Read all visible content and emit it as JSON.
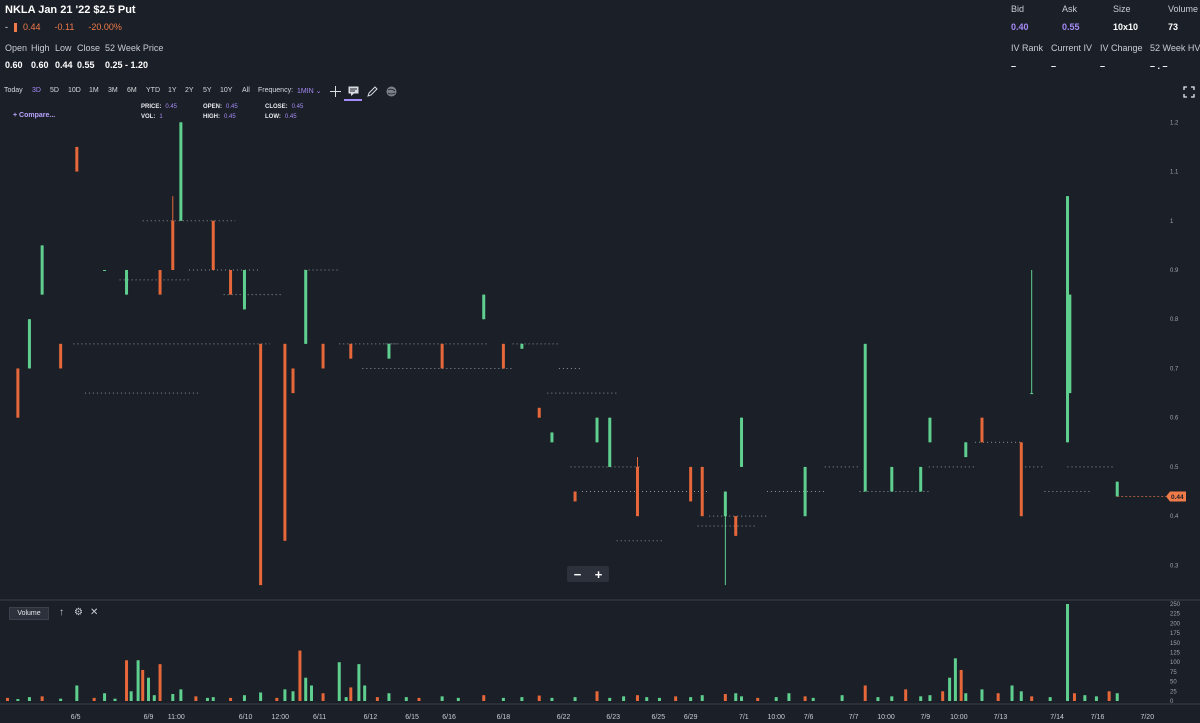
{
  "header": {
    "title": "NKLA Jan 21 '22 $2.5 Put",
    "change_dash": "-",
    "last": "0.44",
    "change": "-0.11",
    "change_pct": "-20.00%"
  },
  "ohlc": {
    "labels": [
      "Open",
      "High",
      "Low",
      "Close",
      "52 Week Price"
    ],
    "values": [
      "0.60",
      "0.60",
      "0.44",
      "0.55",
      "0.25 - 1.20"
    ]
  },
  "quote": {
    "bid_label": "Bid",
    "bid": "0.40",
    "ask_label": "Ask",
    "ask": "0.55",
    "size_label": "Size",
    "size": "10x10",
    "volume_label": "Volume",
    "volume": "73",
    "iv_rank_label": "IV Rank",
    "iv_rank": "–",
    "current_iv_label": "Current IV",
    "current_iv": "–",
    "iv_change_label": "IV Change",
    "iv_change": "–",
    "hv_label": "52 Week HV",
    "hv": "– . –"
  },
  "toolbar": {
    "timeframes": [
      "Today",
      "3D",
      "5D",
      "10D",
      "1M",
      "3M",
      "6M",
      "YTD",
      "1Y",
      "2Y",
      "5Y",
      "10Y",
      "All"
    ],
    "active_timeframe": "3D",
    "frequency_label": "Frequency:",
    "frequency_value": "1MIN ⌄"
  },
  "compare_label": "+ Compare...",
  "legend": {
    "price_label": "PRICE:",
    "price": "0.45",
    "vol_label": "VOL:",
    "vol": "1",
    "open_label": "OPEN:",
    "open": "0.45",
    "high_label": "HIGH:",
    "high": "0.45",
    "close_label": "CLOSE:",
    "close": "0.45",
    "low_label": "LOW:",
    "low": "0.45"
  },
  "volume_panel": {
    "title": "Volume"
  },
  "colors": {
    "up": "#5fcf8f",
    "down": "#e5673a",
    "accent": "#a58bf7",
    "background": "#1b1f27",
    "last_price_tag": "#f07b4a"
  },
  "icons": [
    "crosshair-icon",
    "annotation-icon",
    "pencil-icon",
    "globe-icon",
    "fullscreen-icon",
    "arrow-up-icon",
    "gear-icon",
    "close-icon"
  ],
  "chart_data": {
    "type": "candlestick",
    "x_tick_labels": [
      "6/5",
      "6/9",
      "11:00",
      "6/10",
      "12:00",
      "6/11",
      "6/12",
      "6/15",
      "6/16",
      "6/18",
      "6/22",
      "6/23",
      "6/25",
      "6/29",
      "7/1",
      "10:00",
      "7/6",
      "7/7",
      "10:00",
      "7/9",
      "10:00",
      "7/13",
      "7/14",
      "7/16",
      "7/20"
    ],
    "y_ticks": [
      0.3,
      0.4,
      0.5,
      0.6,
      0.7,
      0.8,
      0.9,
      1,
      1.1,
      1.2
    ],
    "y_tick_labels": [
      "0.3",
      "0.4",
      "0.5",
      "0.6",
      "0.7",
      "0.8",
      "0.9",
      "1",
      "1.1",
      "1.2"
    ],
    "ylim": [
      0.25,
      1.2
    ],
    "last_price": 0.44,
    "last_price_label": "0.44",
    "volume_ticks": [
      0,
      25,
      50,
      75,
      100,
      125,
      150,
      175,
      200,
      225,
      250
    ],
    "volume_ylim": [
      0,
      250
    ],
    "candles": [
      {
        "x": 0.012,
        "o": 0.7,
        "h": 0.7,
        "l": 0.6,
        "c": 0.6
      },
      {
        "x": 0.022,
        "o": 0.7,
        "h": 0.8,
        "l": 0.7,
        "c": 0.8
      },
      {
        "x": 0.033,
        "o": 0.85,
        "h": 0.95,
        "l": 0.85,
        "c": 0.95
      },
      {
        "x": 0.049,
        "o": 0.75,
        "h": 0.75,
        "l": 0.7,
        "c": 0.7
      },
      {
        "x": 0.063,
        "o": 1.15,
        "h": 1.15,
        "l": 1.1,
        "c": 1.1
      },
      {
        "x": 0.087,
        "o": 0.9,
        "h": 0.9,
        "l": 0.9,
        "c": 0.9
      },
      {
        "x": 0.106,
        "o": 0.85,
        "h": 0.9,
        "l": 0.85,
        "c": 0.9
      },
      {
        "x": 0.135,
        "o": 0.9,
        "h": 0.9,
        "l": 0.85,
        "c": 0.85
      },
      {
        "x": 0.146,
        "o": 1.0,
        "h": 1.05,
        "l": 0.9,
        "c": 0.9
      },
      {
        "x": 0.153,
        "o": 1.0,
        "h": 1.2,
        "l": 1.0,
        "c": 1.2
      },
      {
        "x": 0.181,
        "o": 1.0,
        "h": 1.0,
        "l": 0.9,
        "c": 0.9
      },
      {
        "x": 0.196,
        "o": 0.9,
        "h": 0.9,
        "l": 0.85,
        "c": 0.85
      },
      {
        "x": 0.208,
        "o": 0.82,
        "h": 0.9,
        "l": 0.82,
        "c": 0.9
      },
      {
        "x": 0.222,
        "o": 0.75,
        "h": 0.75,
        "l": 0.26,
        "c": 0.26
      },
      {
        "x": 0.243,
        "o": 0.75,
        "h": 0.75,
        "l": 0.35,
        "c": 0.35
      },
      {
        "x": 0.25,
        "o": 0.7,
        "h": 0.7,
        "l": 0.65,
        "c": 0.65
      },
      {
        "x": 0.261,
        "o": 0.75,
        "h": 0.9,
        "l": 0.75,
        "c": 0.9
      },
      {
        "x": 0.276,
        "o": 0.75,
        "h": 0.75,
        "l": 0.7,
        "c": 0.7
      },
      {
        "x": 0.3,
        "o": 0.75,
        "h": 0.75,
        "l": 0.72,
        "c": 0.72
      },
      {
        "x": 0.333,
        "o": 0.72,
        "h": 0.75,
        "l": 0.72,
        "c": 0.75
      },
      {
        "x": 0.379,
        "o": 0.75,
        "h": 0.75,
        "l": 0.7,
        "c": 0.7
      },
      {
        "x": 0.415,
        "o": 0.8,
        "h": 0.85,
        "l": 0.8,
        "c": 0.85
      },
      {
        "x": 0.432,
        "o": 0.75,
        "h": 0.75,
        "l": 0.7,
        "c": 0.7
      },
      {
        "x": 0.448,
        "o": 0.74,
        "h": 0.75,
        "l": 0.74,
        "c": 0.75
      },
      {
        "x": 0.463,
        "o": 0.62,
        "h": 0.62,
        "l": 0.6,
        "c": 0.6
      },
      {
        "x": 0.474,
        "o": 0.55,
        "h": 0.57,
        "l": 0.55,
        "c": 0.57
      },
      {
        "x": 0.494,
        "o": 0.45,
        "h": 0.45,
        "l": 0.43,
        "c": 0.43
      },
      {
        "x": 0.513,
        "o": 0.55,
        "h": 0.6,
        "l": 0.55,
        "c": 0.6
      },
      {
        "x": 0.524,
        "o": 0.5,
        "h": 0.6,
        "l": 0.5,
        "c": 0.6
      },
      {
        "x": 0.548,
        "o": 0.5,
        "h": 0.52,
        "l": 0.4,
        "c": 0.4
      },
      {
        "x": 0.594,
        "o": 0.5,
        "h": 0.5,
        "l": 0.43,
        "c": 0.43
      },
      {
        "x": 0.604,
        "o": 0.5,
        "h": 0.5,
        "l": 0.4,
        "c": 0.4
      },
      {
        "x": 0.624,
        "o": 0.4,
        "h": 0.45,
        "l": 0.26,
        "c": 0.45
      },
      {
        "x": 0.633,
        "o": 0.4,
        "h": 0.4,
        "l": 0.36,
        "c": 0.36
      },
      {
        "x": 0.638,
        "o": 0.5,
        "h": 0.6,
        "l": 0.5,
        "c": 0.6
      },
      {
        "x": 0.693,
        "o": 0.4,
        "h": 0.5,
        "l": 0.4,
        "c": 0.5
      },
      {
        "x": 0.745,
        "o": 0.45,
        "h": 0.75,
        "l": 0.45,
        "c": 0.75
      },
      {
        "x": 0.768,
        "o": 0.45,
        "h": 0.5,
        "l": 0.45,
        "c": 0.5
      },
      {
        "x": 0.793,
        "o": 0.45,
        "h": 0.5,
        "l": 0.45,
        "c": 0.5
      },
      {
        "x": 0.801,
        "o": 0.55,
        "h": 0.6,
        "l": 0.55,
        "c": 0.6
      },
      {
        "x": 0.832,
        "o": 0.52,
        "h": 0.55,
        "l": 0.52,
        "c": 0.55
      },
      {
        "x": 0.846,
        "o": 0.6,
        "h": 0.6,
        "l": 0.55,
        "c": 0.55
      },
      {
        "x": 0.88,
        "o": 0.55,
        "h": 0.55,
        "l": 0.4,
        "c": 0.4
      },
      {
        "x": 0.889,
        "o": 0.65,
        "h": 0.9,
        "l": 0.65,
        "c": 0.65
      },
      {
        "x": 0.92,
        "o": 0.55,
        "h": 1.05,
        "l": 0.55,
        "c": 1.05
      },
      {
        "x": 0.922,
        "o": 0.65,
        "h": 0.85,
        "l": 0.65,
        "c": 0.85
      },
      {
        "x": 0.963,
        "o": 0.44,
        "h": 0.47,
        "l": 0.44,
        "c": 0.47
      }
    ],
    "volumes": [
      {
        "x": 0.003,
        "v": 8
      },
      {
        "x": 0.012,
        "v": 5
      },
      {
        "x": 0.022,
        "v": 10
      },
      {
        "x": 0.033,
        "v": 12
      },
      {
        "x": 0.049,
        "v": 6
      },
      {
        "x": 0.063,
        "v": 40
      },
      {
        "x": 0.078,
        "v": 8
      },
      {
        "x": 0.087,
        "v": 20
      },
      {
        "x": 0.096,
        "v": 6
      },
      {
        "x": 0.106,
        "v": 105
      },
      {
        "x": 0.11,
        "v": 25
      },
      {
        "x": 0.116,
        "v": 105
      },
      {
        "x": 0.12,
        "v": 80
      },
      {
        "x": 0.125,
        "v": 60
      },
      {
        "x": 0.13,
        "v": 15
      },
      {
        "x": 0.135,
        "v": 95
      },
      {
        "x": 0.146,
        "v": 18
      },
      {
        "x": 0.153,
        "v": 30
      },
      {
        "x": 0.166,
        "v": 12
      },
      {
        "x": 0.176,
        "v": 8
      },
      {
        "x": 0.181,
        "v": 10
      },
      {
        "x": 0.196,
        "v": 8
      },
      {
        "x": 0.208,
        "v": 15
      },
      {
        "x": 0.222,
        "v": 22
      },
      {
        "x": 0.236,
        "v": 8
      },
      {
        "x": 0.243,
        "v": 30
      },
      {
        "x": 0.25,
        "v": 25
      },
      {
        "x": 0.256,
        "v": 130
      },
      {
        "x": 0.261,
        "v": 60
      },
      {
        "x": 0.266,
        "v": 40
      },
      {
        "x": 0.276,
        "v": 20
      },
      {
        "x": 0.29,
        "v": 100
      },
      {
        "x": 0.296,
        "v": 10
      },
      {
        "x": 0.3,
        "v": 35
      },
      {
        "x": 0.307,
        "v": 95
      },
      {
        "x": 0.312,
        "v": 40
      },
      {
        "x": 0.323,
        "v": 10
      },
      {
        "x": 0.333,
        "v": 20
      },
      {
        "x": 0.348,
        "v": 10
      },
      {
        "x": 0.359,
        "v": 8
      },
      {
        "x": 0.379,
        "v": 12
      },
      {
        "x": 0.393,
        "v": 8
      },
      {
        "x": 0.415,
        "v": 15
      },
      {
        "x": 0.432,
        "v": 8
      },
      {
        "x": 0.448,
        "v": 10
      },
      {
        "x": 0.463,
        "v": 14
      },
      {
        "x": 0.474,
        "v": 8
      },
      {
        "x": 0.494,
        "v": 10
      },
      {
        "x": 0.513,
        "v": 25
      },
      {
        "x": 0.524,
        "v": 8
      },
      {
        "x": 0.536,
        "v": 12
      },
      {
        "x": 0.548,
        "v": 15
      },
      {
        "x": 0.556,
        "v": 10
      },
      {
        "x": 0.567,
        "v": 8
      },
      {
        "x": 0.581,
        "v": 12
      },
      {
        "x": 0.594,
        "v": 10
      },
      {
        "x": 0.604,
        "v": 15
      },
      {
        "x": 0.624,
        "v": 18
      },
      {
        "x": 0.633,
        "v": 20
      },
      {
        "x": 0.638,
        "v": 12
      },
      {
        "x": 0.652,
        "v": 8
      },
      {
        "x": 0.668,
        "v": 10
      },
      {
        "x": 0.679,
        "v": 20
      },
      {
        "x": 0.693,
        "v": 12
      },
      {
        "x": 0.7,
        "v": 8
      },
      {
        "x": 0.725,
        "v": 15
      },
      {
        "x": 0.745,
        "v": 40
      },
      {
        "x": 0.756,
        "v": 10
      },
      {
        "x": 0.768,
        "v": 12
      },
      {
        "x": 0.78,
        "v": 30
      },
      {
        "x": 0.793,
        "v": 12
      },
      {
        "x": 0.801,
        "v": 15
      },
      {
        "x": 0.812,
        "v": 25
      },
      {
        "x": 0.818,
        "v": 60
      },
      {
        "x": 0.823,
        "v": 110
      },
      {
        "x": 0.828,
        "v": 80
      },
      {
        "x": 0.832,
        "v": 20
      },
      {
        "x": 0.846,
        "v": 30
      },
      {
        "x": 0.86,
        "v": 20
      },
      {
        "x": 0.872,
        "v": 40
      },
      {
        "x": 0.88,
        "v": 25
      },
      {
        "x": 0.889,
        "v": 12
      },
      {
        "x": 0.905,
        "v": 10
      },
      {
        "x": 0.92,
        "v": 250
      },
      {
        "x": 0.926,
        "v": 20
      },
      {
        "x": 0.935,
        "v": 15
      },
      {
        "x": 0.945,
        "v": 12
      },
      {
        "x": 0.956,
        "v": 25
      },
      {
        "x": 0.963,
        "v": 20
      }
    ]
  }
}
